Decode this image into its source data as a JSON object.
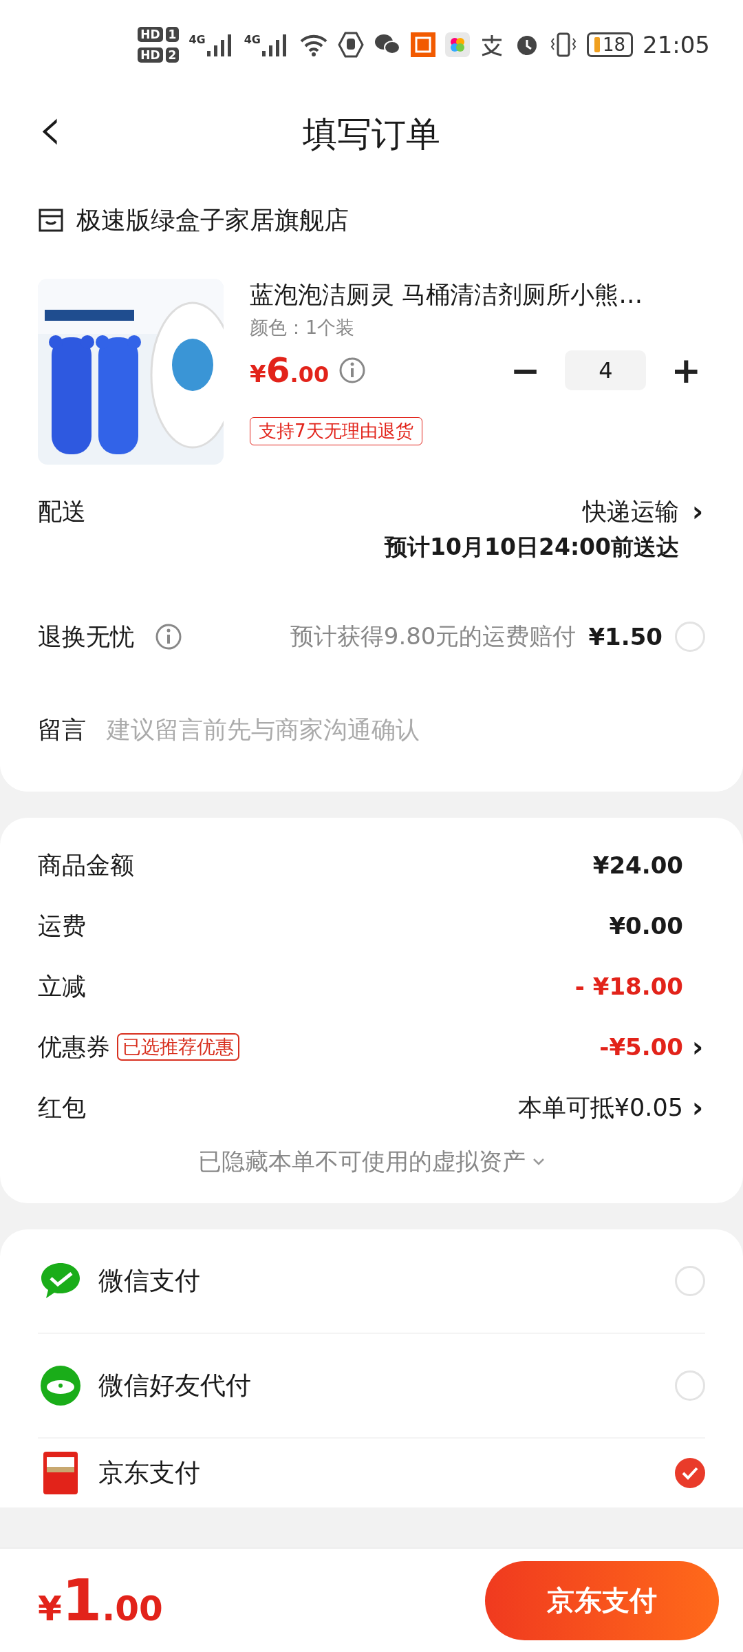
{
  "status_bar": {
    "sims": [
      {
        "badge": "HD",
        "slot": "1"
      },
      {
        "badge": "HD",
        "slot": "2"
      }
    ],
    "networks": [
      "4G",
      "4G"
    ],
    "battery": "18",
    "time": "21:05"
  },
  "header": {
    "back": "‹",
    "title": "填写订单"
  },
  "shop": {
    "name": "极速版绿盒子家居旗舰店"
  },
  "product": {
    "kind": "picture",
    "title": "蓝泡泡洁厕灵 马桶清洁剂厕所小熊…",
    "spec": "颜色：1个装",
    "price_symbol": "¥",
    "price_int": "6",
    "price_dec": ".00",
    "minus": "−",
    "quantity": "4",
    "plus": "+",
    "tag": "支持7天无理由退货"
  },
  "delivery": {
    "label": "配送",
    "method": "快递运输",
    "chevron": "›",
    "eta": "预计10月10日24:00前送达"
  },
  "return_insurance": {
    "label": "退换无忧",
    "note": "预计获得9.80元的运费赔付",
    "price": "¥1.50",
    "checked": false
  },
  "message": {
    "label": "留言",
    "placeholder": "建议留言前先与商家沟通确认"
  },
  "summary": {
    "rows": [
      {
        "label": "商品金额",
        "value": "¥24.00",
        "red": false
      },
      {
        "label": "运费",
        "value": "¥0.00",
        "red": false
      },
      {
        "label": "立减",
        "value": "- ¥18.00",
        "red": true
      },
      {
        "label": "优惠券",
        "badge": "已选推荐优惠",
        "value": "-¥5.00",
        "red": true,
        "chevron": "›"
      },
      {
        "label": "红包",
        "value": "本单可抵¥0.05",
        "red": false,
        "chevron": "›"
      }
    ],
    "hidden_note": "已隐藏本单不可使用的虚拟资产"
  },
  "payments": [
    {
      "kind": "wechat",
      "label": "微信支付",
      "selected": false
    },
    {
      "kind": "friend",
      "label": "微信好友代付",
      "selected": false
    },
    {
      "kind": "jd",
      "label": "京东支付",
      "selected": true
    }
  ],
  "footer": {
    "symbol": "¥",
    "int": "1",
    "dec": ".00",
    "button": "京东支付"
  }
}
